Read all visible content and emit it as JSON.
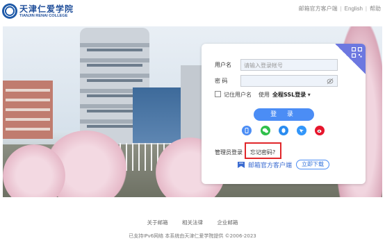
{
  "header": {
    "logo_cn": "天津仁爱学院",
    "logo_en": "TIANJIN RENAI COLLEGE",
    "links": [
      "邮箱官方客户端",
      "English",
      "帮助"
    ]
  },
  "login": {
    "username_label": "用户名",
    "username_placeholder": "请输入登录帐号",
    "password_label": "密 码",
    "remember_label": "记住用户名",
    "use_label": "使用",
    "ssl_label": "全程SSL登录",
    "login_button": "登 录",
    "admin_login": "管理员登录",
    "forgot_password": "忘记密码?",
    "client_label": "邮箱官方客户端",
    "download_button": "立即下载",
    "social_icons": [
      "mobile-icon",
      "wechat-icon",
      "qq-icon",
      "dingtalk-icon",
      "weibo-icon"
    ]
  },
  "footer": {
    "links": [
      "关于邮箱",
      "相关法律",
      "企业邮箱"
    ],
    "copyright": "已支持IPv6网络 本系统由天津仁爱学院提供 ©2006-2023"
  },
  "colors": {
    "accent": "#4b8df5",
    "highlight": "#e0262a",
    "brand": "#1f4e9a"
  }
}
